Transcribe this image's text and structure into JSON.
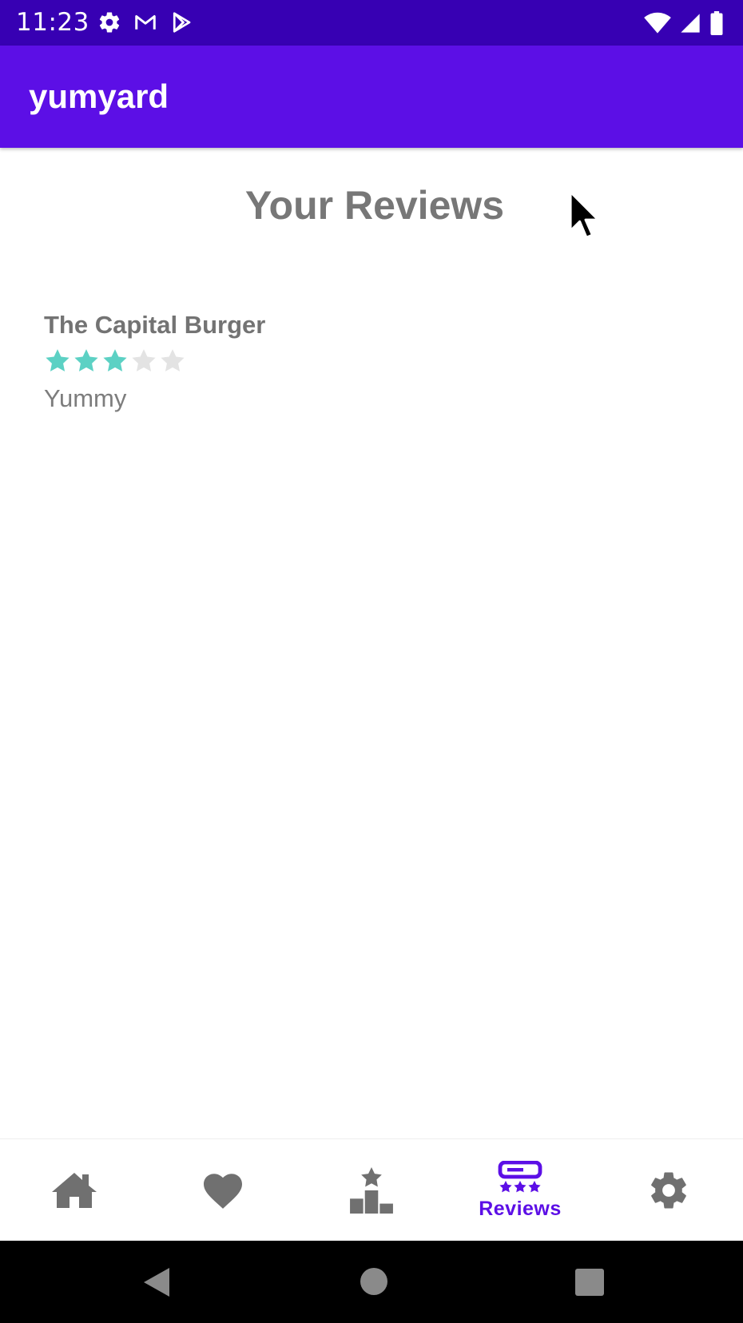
{
  "status_bar": {
    "time": "11:23",
    "left_icons": [
      "gear-icon",
      "gmail-icon",
      "play-store-icon"
    ],
    "right_icons": [
      "wifi-icon",
      "signal-icon",
      "battery-icon"
    ],
    "background": "#3700b3"
  },
  "app_bar": {
    "title": "yumyard",
    "background": "#5c0fe6"
  },
  "page": {
    "title": "Your Reviews"
  },
  "reviews": [
    {
      "restaurant": "The Capital Burger",
      "rating": 3,
      "max_rating": 5,
      "comment": "Yummy",
      "star_color": "#5cd1c4",
      "empty_star_color": "#e3e3e3"
    }
  ],
  "bottom_nav": {
    "items": [
      {
        "icon": "home-icon",
        "label": "",
        "active": false
      },
      {
        "icon": "heart-icon",
        "label": "",
        "active": false
      },
      {
        "icon": "leaderboard-icon",
        "label": "",
        "active": false
      },
      {
        "icon": "reviews-icon",
        "label": "Reviews",
        "active": true
      },
      {
        "icon": "settings-icon",
        "label": "",
        "active": false
      }
    ],
    "active_color": "#5c0fe6",
    "inactive_color": "#707070"
  },
  "system_nav": {
    "buttons": [
      "back-icon",
      "home-circle-icon",
      "recents-icon"
    ]
  }
}
